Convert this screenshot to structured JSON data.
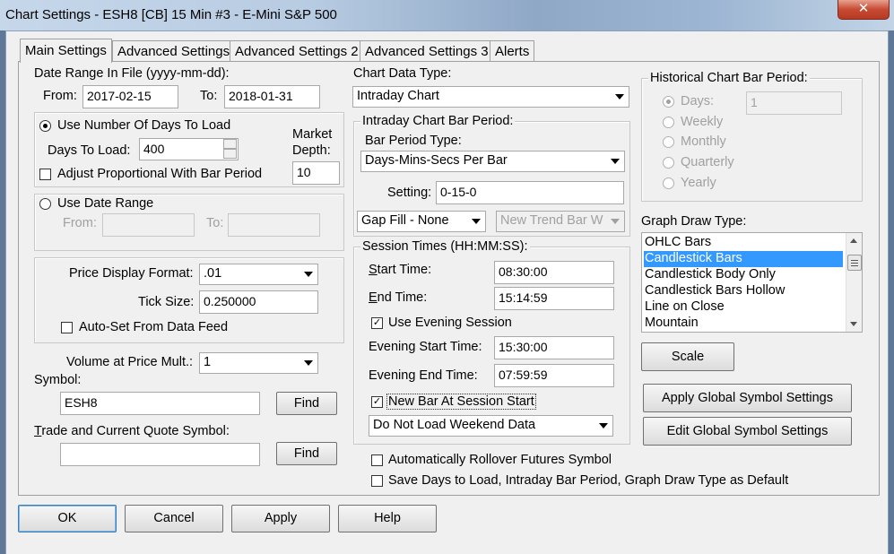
{
  "window": {
    "title": "Chart Settings - ESH8 [CB]  15 Min   #3 - E-Mini S&P 500",
    "close": "✕"
  },
  "tabs": [
    "Main Settings",
    "Advanced Settings",
    "Advanced Settings 2",
    "Advanced Settings 3",
    "Alerts"
  ],
  "date_range": {
    "label": "Date Range In File (yyyy-mm-dd):",
    "from_label": "From:",
    "from": "2017-02-15",
    "to_label": "To:",
    "to": "2018-01-31"
  },
  "days": {
    "radio_label": "Use Number Of Days To Load",
    "days_label": "Days To Load:",
    "days_value": "400",
    "market_depth_label_1": "Market",
    "market_depth_label_2": "Depth:",
    "market_depth_value": "10",
    "adjust_label": "Adjust Proportional With Bar Period"
  },
  "date_range_opt": {
    "radio_label": "Use Date Range",
    "from_label": "From:",
    "to_label": "To:"
  },
  "price": {
    "format_label": "Price Display Format:",
    "format_value": ".01",
    "tick_label": "Tick Size:",
    "tick_value": "0.250000",
    "autoset_label": "Auto-Set From Data Feed"
  },
  "vap": {
    "label": "Volume at Price Mult.:",
    "value": "1"
  },
  "symbol": {
    "label": "Symbol:",
    "value": "ESH8",
    "find": "Find"
  },
  "trade_symbol": {
    "label": "Trade and Current Quote Symbol:",
    "value": "",
    "find": "Find"
  },
  "chart_type": {
    "label": "Chart Data Type:",
    "value": "Intraday Chart"
  },
  "intraday": {
    "legend": "Intraday Chart Bar Period:",
    "type_label": "Bar Period Type:",
    "type_value": "Days-Mins-Secs Per Bar",
    "setting_label": "Setting:",
    "setting_value": "0-15-0",
    "gapfill": "Gap Fill - None",
    "newtrend": "New Trend Bar W"
  },
  "session": {
    "legend": "Session Times (HH:MM:SS):",
    "start_label": "Start Time:",
    "start": "08:30:00",
    "end_label": "End Time:",
    "end": "15:14:59",
    "evening_label": "Use Evening Session",
    "evening_start_label": "Evening Start Time:",
    "evening_start": "15:30:00",
    "evening_end_label": "Evening End Time:",
    "evening_end": "07:59:59",
    "newbar_label": "New Bar At Session Start",
    "weekend": "Do Not Load Weekend Data"
  },
  "rollover_label": "Automatically Rollover Futures Symbol",
  "save_default_label": "Save Days to Load, Intraday Bar Period, Graph Draw Type as Default",
  "historical": {
    "legend": "Historical Chart Bar Period:",
    "days_label": "Days:",
    "days_value": "1",
    "weekly": "Weekly",
    "monthly": "Monthly",
    "quarterly": "Quarterly",
    "yearly": "Yearly"
  },
  "graph_draw": {
    "label": "Graph Draw Type:",
    "items": [
      "OHLC Bars",
      "Candlestick Bars",
      "Candlestick Body Only",
      "Candlestick Bars Hollow",
      "Line on Close",
      "Mountain"
    ],
    "selected": "Candlestick Bars"
  },
  "buttons": {
    "scale": "Scale",
    "apply_global": "Apply Global Symbol Settings",
    "edit_global": "Edit Global Symbol Settings",
    "ok": "OK",
    "cancel": "Cancel",
    "apply": "Apply",
    "help": "Help"
  },
  "check": "✓"
}
